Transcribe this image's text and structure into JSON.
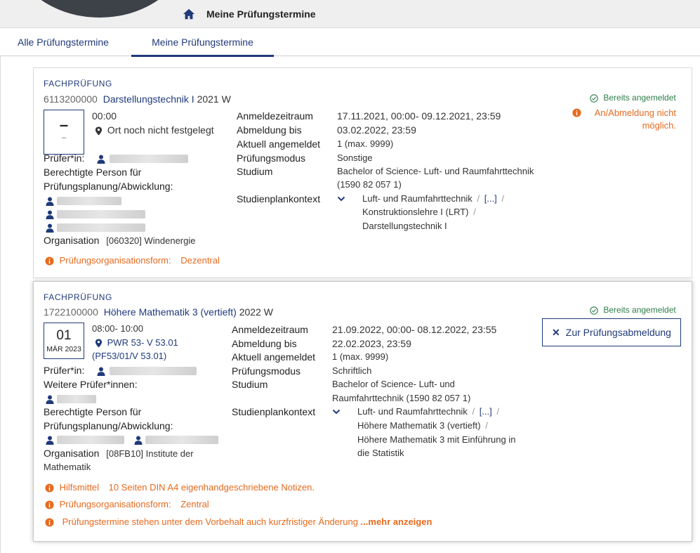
{
  "header": {
    "title": "Meine Prüfungstermine"
  },
  "tabs": [
    {
      "label": "Alle Prüfungstermine"
    },
    {
      "label": "Meine Prüfungstermine"
    }
  ],
  "exams": [
    {
      "kind": "FACHPRÜFUNG",
      "number": "6113200000",
      "course": "Darstellungstechnik I",
      "semester": "2021 W",
      "status": "Bereits angemeldet",
      "warning": "An/Abmeldung nicht möglich.",
      "date_day": "–",
      "date_sub": "–",
      "time": "00:00",
      "location": "Ort noch nicht festgelegt",
      "labels": {
        "examiner": "Prüfer*in:",
        "responsible_1": "Berechtigte Person für",
        "responsible_2": "Prüfungsplanung/Abwicklung:",
        "organisation": "Organisation"
      },
      "organisation_value": "[060320] Windenergie",
      "info_org_form_label": "Prüfungsorganisationsform:",
      "info_org_form_value": "Dezentral",
      "details": {
        "reg_period_label": "Anmeldezeitraum",
        "reg_period_value": "17.11.2021, 00:00- 09.12.2021, 23:59",
        "dereg_label": "Abmeldung bis",
        "dereg_value": "03.02.2022, 23:59",
        "registered_label": "Aktuell angemeldet",
        "registered_value": "1 (max. 9999)",
        "mode_label": "Prüfungsmodus",
        "mode_value": "Sonstige",
        "study_label": "Studium",
        "study_value_1": "Bachelor of Science- Luft- und Raumfahrttechnik",
        "study_value_2": "(1590 82 057 1)",
        "context_label": "Studienplankontext",
        "context_1": "Luft- und Raumfahrttechnik",
        "context_link": "[...]",
        "context_2": "Konstruktionslehre I (LRT)",
        "context_3": "Darstellungstechnik I"
      }
    },
    {
      "kind": "FACHPRÜFUNG",
      "number": "1722100000",
      "course": "Höhere Mathematik 3 (vertieft)",
      "semester": "2022 W",
      "status": "Bereits angemeldet",
      "deregister_button": "Zur Prüfungsabmeldung",
      "date_day": "01",
      "date_month": "MÄR 2023",
      "time": "08:00- 10:00",
      "location_1": "PWR 53- V 53.01",
      "location_2": "(PF53/01/V 53.01)",
      "labels": {
        "examiner": "Prüfer*in:",
        "further_examiners": "Weitere Prüfer*innen:",
        "responsible_1": "Berechtigte Person für",
        "responsible_2": "Prüfungsplanung/Abwicklung:",
        "organisation": "Organisation"
      },
      "organisation_value_1": "[08FB10] Institute der",
      "organisation_value_2": "Mathematik",
      "info_aids_label": "Hilfsmittel",
      "info_aids_value": "10 Seiten DIN A4 eigenhandgeschriebene Notizen.",
      "info_org_form_label": "Prüfungsorganisationsform:",
      "info_org_form_value": "Zentral",
      "info_notice": "Prüfungstermine stehen unter dem Vorbehalt auch kurzfristiger Änderung",
      "info_more": "...mehr anzeigen",
      "details": {
        "reg_period_label": "Anmeldezeitraum",
        "reg_period_value": "21.09.2022, 00:00- 08.12.2022, 23:55",
        "dereg_label": "Abmeldung bis",
        "dereg_value": "22.02.2023, 23:59",
        "registered_label": "Aktuell angemeldet",
        "registered_value": "1 (max. 9999)",
        "mode_label": "Prüfungsmodus",
        "mode_value": "Schriftlich",
        "study_label": "Studium",
        "study_value_1": "Bachelor of Science- Luft- und",
        "study_value_2": "Raumfahrttechnik (1590 82 057 1)",
        "context_label": "Studienplankontext",
        "context_1": "Luft- und Raumfahrttechnik",
        "context_link": "[...]",
        "context_2": "Höhere Mathematik 3 (vertieft)",
        "context_3": "Höhere Mathematik 3 mit Einführung in",
        "context_4": "die Statistik"
      }
    }
  ],
  "colors": {
    "accent": "#1f3a7a",
    "warning": "#e66a1e",
    "success": "#2f7d4a"
  },
  "icons": [
    "home-icon",
    "check-circle-icon",
    "info-icon",
    "map-pin-icon",
    "person-icon",
    "chevron-down-icon",
    "close-icon"
  ]
}
